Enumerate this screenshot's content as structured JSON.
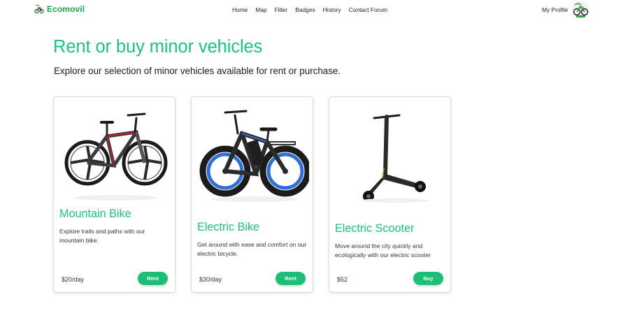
{
  "brand": {
    "name": "Ecomovil",
    "icon": "bike-logo-icon",
    "color": "#1fa54a"
  },
  "nav": {
    "links": [
      "Home",
      "Map",
      "Filter",
      "Badges",
      "History",
      "Contact Forum"
    ],
    "profile_label": "My Profile",
    "avatar_icon": "bike-avatar-icon"
  },
  "hero": {
    "title": "Rent or buy minor vehicles",
    "subtitle": "Explore our selection of minor vehicles available for rent or purchase."
  },
  "accent_color": "#1cc27d",
  "cards": [
    {
      "image": "mountain-bike-image",
      "title": "Mountain Bike",
      "description": "Explore trails and paths with our mountain bike.",
      "price": "$20/day",
      "action": "Rent"
    },
    {
      "image": "electric-bike-image",
      "title": "Electric Bike",
      "description": "Get around with ease and comfort on our electric bicycle.",
      "price": "$30/day",
      "action": "Rent"
    },
    {
      "image": "electric-scooter-image",
      "title": "Electric Scooter",
      "description": "Move around the city quickly and ecologically with our electric scooter",
      "price": "$52",
      "action": "Buy"
    }
  ]
}
